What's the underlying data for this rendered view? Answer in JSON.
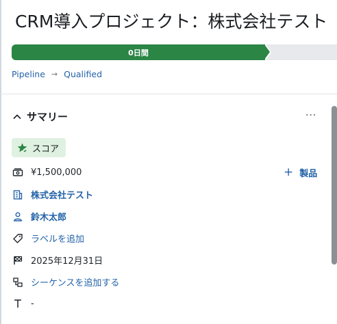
{
  "header": {
    "title": "CRM導入プロジェクト：株式会社テスト"
  },
  "stage": {
    "active_label": "0日間"
  },
  "breadcrumb": {
    "items": [
      "Pipeline",
      "Qualified"
    ]
  },
  "summary": {
    "title": "サマリー",
    "more": "···",
    "score_label": "スコア",
    "amount": "¥1,500,000",
    "add_product_plus": "+",
    "add_product_label": "製品",
    "company": "株式会社テスト",
    "owner": "鈴木太郎",
    "add_label": "ラベルを追加",
    "due_date": "2025年12月31日",
    "add_sequence": "シーケンスを追加する",
    "text_value": "-"
  },
  "colors": {
    "stage_active": "#2b8545",
    "link": "#2463a8",
    "score_bg": "#dff1e0"
  },
  "icons": [
    "chevron-up-icon",
    "star-badge-icon",
    "money-icon",
    "building-icon",
    "person-icon",
    "tag-icon",
    "flag-icon",
    "sequence-icon",
    "text-icon"
  ]
}
